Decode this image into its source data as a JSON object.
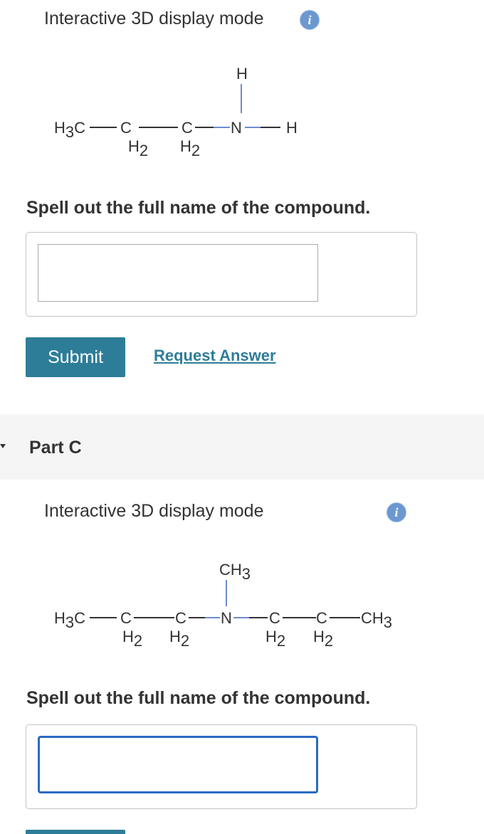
{
  "part_b": {
    "display_mode_label": "Interactive 3D display mode",
    "info_icon": "info-icon",
    "molecule": {
      "atoms": {
        "methyl_c": "H",
        "methyl_sub": "3",
        "c_label": "C",
        "h2_h": "H",
        "h2_sub": "2",
        "n": "N",
        "h": "H"
      }
    },
    "prompt": "Spell out the full name of the compound.",
    "answer_value": "",
    "submit_label": "Submit",
    "request_answer_label": "Request Answer"
  },
  "part_c": {
    "title": "Part C",
    "display_mode_label": "Interactive 3D display mode",
    "info_icon": "info-icon",
    "molecule": {
      "atoms": {
        "ch": "CH",
        "ch_sub": "3",
        "c_label": "C",
        "h2_h": "H",
        "h2_sub": "2",
        "n": "N"
      }
    },
    "prompt": "Spell out the full name of the compound.",
    "answer_value": ""
  },
  "colors": {
    "accent": "#2e7d98",
    "info_icon": "#6b98cf",
    "bond_n": "#6c8ccf",
    "focus_border": "#2b6ac4",
    "part_band": "#f5f5f5"
  }
}
